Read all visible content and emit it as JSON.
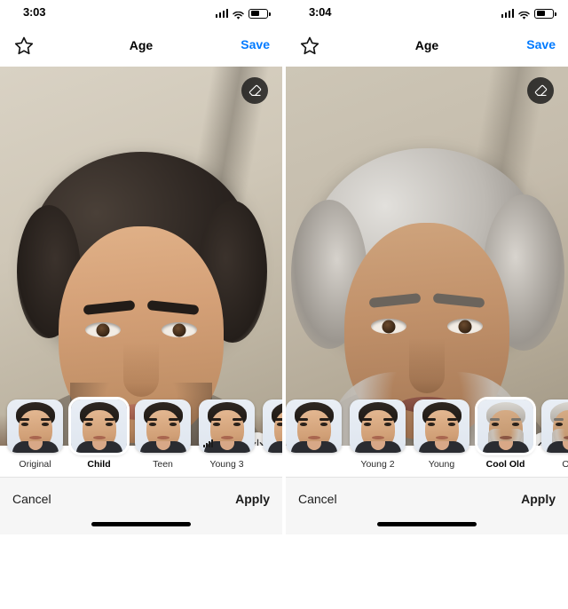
{
  "app": {
    "accent_color": "#007aff",
    "bottom_bar_bg": "#f6f6f6"
  },
  "panels": [
    {
      "id": "left",
      "status": {
        "time": "3:03",
        "signal_icon": "cellular-signal-icon",
        "wifi_icon": "wifi-icon",
        "battery_icon": "battery-icon"
      },
      "nav": {
        "favorite_icon": "star-outline-icon",
        "title": "Age",
        "save_label": "Save"
      },
      "photo": {
        "eraser_icon": "eraser-icon",
        "compare_icon": "compare-slider-icon",
        "variant": "young"
      },
      "thumbnails": [
        {
          "label": "Original",
          "selected": false,
          "style": "young",
          "ad": false,
          "partial": false
        },
        {
          "label": "Child",
          "selected": true,
          "style": "young",
          "ad": false,
          "partial": false
        },
        {
          "label": "Teen",
          "selected": false,
          "style": "young",
          "ad": false,
          "partial": false
        },
        {
          "label": "Young 3",
          "selected": false,
          "style": "young",
          "ad": true,
          "partial": false
        },
        {
          "label": "",
          "selected": false,
          "style": "young",
          "ad": false,
          "partial": true
        }
      ],
      "bottom": {
        "cancel_label": "Cancel",
        "apply_label": "Apply"
      }
    },
    {
      "id": "right",
      "status": {
        "time": "3:04",
        "signal_icon": "cellular-signal-icon",
        "wifi_icon": "wifi-icon",
        "battery_icon": "battery-icon"
      },
      "nav": {
        "favorite_icon": "star-outline-icon",
        "title": "Age",
        "save_label": "Save"
      },
      "photo": {
        "eraser_icon": "eraser-icon",
        "compare_icon": "compare-slider-icon",
        "variant": "old"
      },
      "thumbnails": [
        {
          "label": "",
          "selected": false,
          "style": "young",
          "ad": false,
          "partial": true
        },
        {
          "label": "Young 2",
          "selected": false,
          "style": "young",
          "ad": false,
          "partial": false
        },
        {
          "label": "Young",
          "selected": false,
          "style": "young",
          "ad": false,
          "partial": false
        },
        {
          "label": "Cool Old",
          "selected": true,
          "style": "old",
          "ad": false,
          "partial": false
        },
        {
          "label": "Old",
          "selected": false,
          "style": "old",
          "ad": false,
          "partial": false
        }
      ],
      "bottom": {
        "cancel_label": "Cancel",
        "apply_label": "Apply"
      }
    }
  ]
}
